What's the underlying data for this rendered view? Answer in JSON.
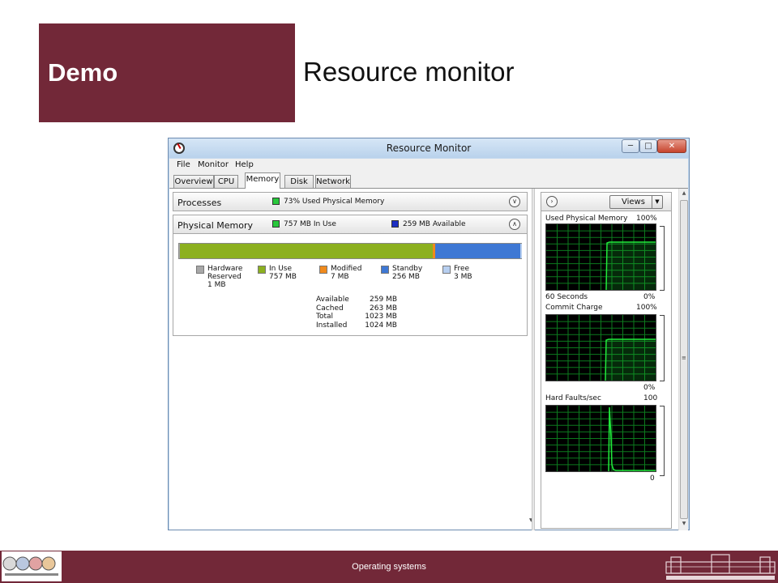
{
  "slide": {
    "heading": "Demo",
    "title": "Resource monitor",
    "footer": "Operating systems"
  },
  "window": {
    "title": "Resource Monitor",
    "menu": [
      "File",
      "Monitor",
      "Help"
    ],
    "tabs": [
      "Overview",
      "CPU",
      "Memory",
      "Disk",
      "Network"
    ],
    "active_tab": "Memory"
  },
  "processes": {
    "label": "Processes",
    "info": "73% Used Physical Memory"
  },
  "physical_memory": {
    "label": "Physical Memory",
    "in_use_info": "757 MB In Use",
    "available_info": "259 MB Available",
    "bar": {
      "hardware_reserved_mb": 1,
      "in_use_mb": 757,
      "modified_mb": 7,
      "standby_mb": 256,
      "free_mb": 3
    },
    "legend": [
      {
        "name": "Hardware",
        "name2": "Reserved",
        "value": "1 MB",
        "color": "#a8a8a8"
      },
      {
        "name": "In Use",
        "name2": "",
        "value": "757 MB",
        "color": "#8cb020"
      },
      {
        "name": "Modified",
        "name2": "",
        "value": "7 MB",
        "color": "#f08a1c"
      },
      {
        "name": "Standby",
        "name2": "",
        "value": "256 MB",
        "color": "#3e78d4"
      },
      {
        "name": "Free",
        "name2": "",
        "value": "3 MB",
        "color": "#b7cff0"
      }
    ],
    "stats": [
      {
        "key": "Available",
        "value": "259 MB"
      },
      {
        "key": "Cached",
        "value": "263 MB"
      },
      {
        "key": "Total",
        "value": "1023 MB"
      },
      {
        "key": "Installed",
        "value": "1024 MB"
      }
    ]
  },
  "right_panel": {
    "views_label": "Views",
    "graphs": [
      {
        "label": "Used Physical Memory",
        "max": "100%",
        "bottom_left": "60 Seconds",
        "bottom_right": "0%"
      },
      {
        "label": "Commit Charge",
        "max": "100%",
        "bottom_left": "",
        "bottom_right": "0%"
      },
      {
        "label": "Hard Faults/sec",
        "max": "100",
        "bottom_left": "",
        "bottom_right": "0"
      }
    ]
  },
  "colors": {
    "accent": "#722838",
    "graph_line": "#21e83b",
    "graph_grid": "#0c7a1e",
    "window_frame": "#c4d9ef"
  }
}
